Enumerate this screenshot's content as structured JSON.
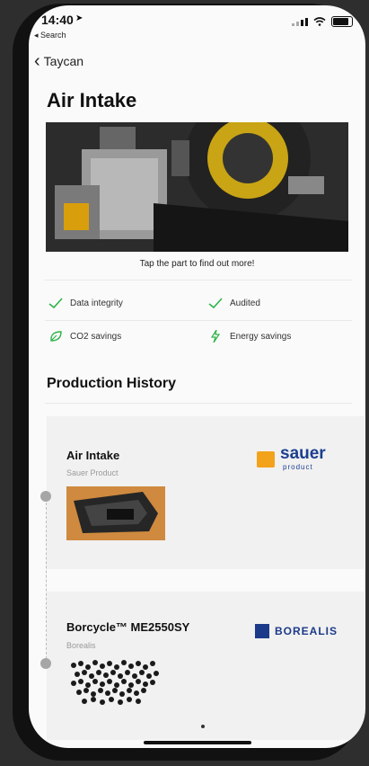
{
  "status_bar": {
    "time": "14:40",
    "back_app": "◂ Search"
  },
  "nav": {
    "back_label": "Taycan"
  },
  "page": {
    "title": "Air Intake"
  },
  "hero": {
    "caption": "Tap the part to find out more!"
  },
  "features": [
    {
      "label": "Data integrity",
      "icon": "checkmark-icon"
    },
    {
      "label": "Audited",
      "icon": "checkmark-icon"
    },
    {
      "label": "CO2 savings",
      "icon": "leaf-icon"
    },
    {
      "label": "Energy savings",
      "icon": "lightning-icon"
    }
  ],
  "history": {
    "title": "Production History",
    "items": [
      {
        "name": "Air Intake",
        "subtitle": "Sauer Product",
        "logo_text": "sauer",
        "logo_sub": "product"
      },
      {
        "name": "Borcycle™ ME2550SY",
        "subtitle": "Borealis",
        "logo_text": "BOREALIS"
      }
    ]
  },
  "colors": {
    "accent_green": "#2fb34a",
    "sauer_blue": "#1b3f8f",
    "sauer_orange": "#f3a21b",
    "borealis_blue": "#1c3a8a"
  }
}
